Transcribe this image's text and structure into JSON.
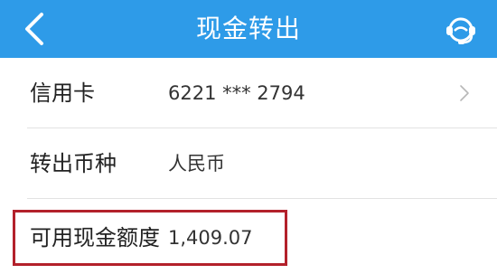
{
  "header": {
    "title": "现金转出",
    "back_icon": "chevron-left-icon",
    "service_icon": "customer-service-icon",
    "background_color": "#2e9be8"
  },
  "rows": [
    {
      "label": "信用卡",
      "value": "6221 *** 2794",
      "has_chevron": true
    },
    {
      "label": "转出币种",
      "value": "人民币",
      "has_chevron": false
    },
    {
      "label": "可用现金额度",
      "value": "1,409.07",
      "has_chevron": false
    }
  ],
  "annotation": {
    "highlight_color": "#b3212b"
  }
}
